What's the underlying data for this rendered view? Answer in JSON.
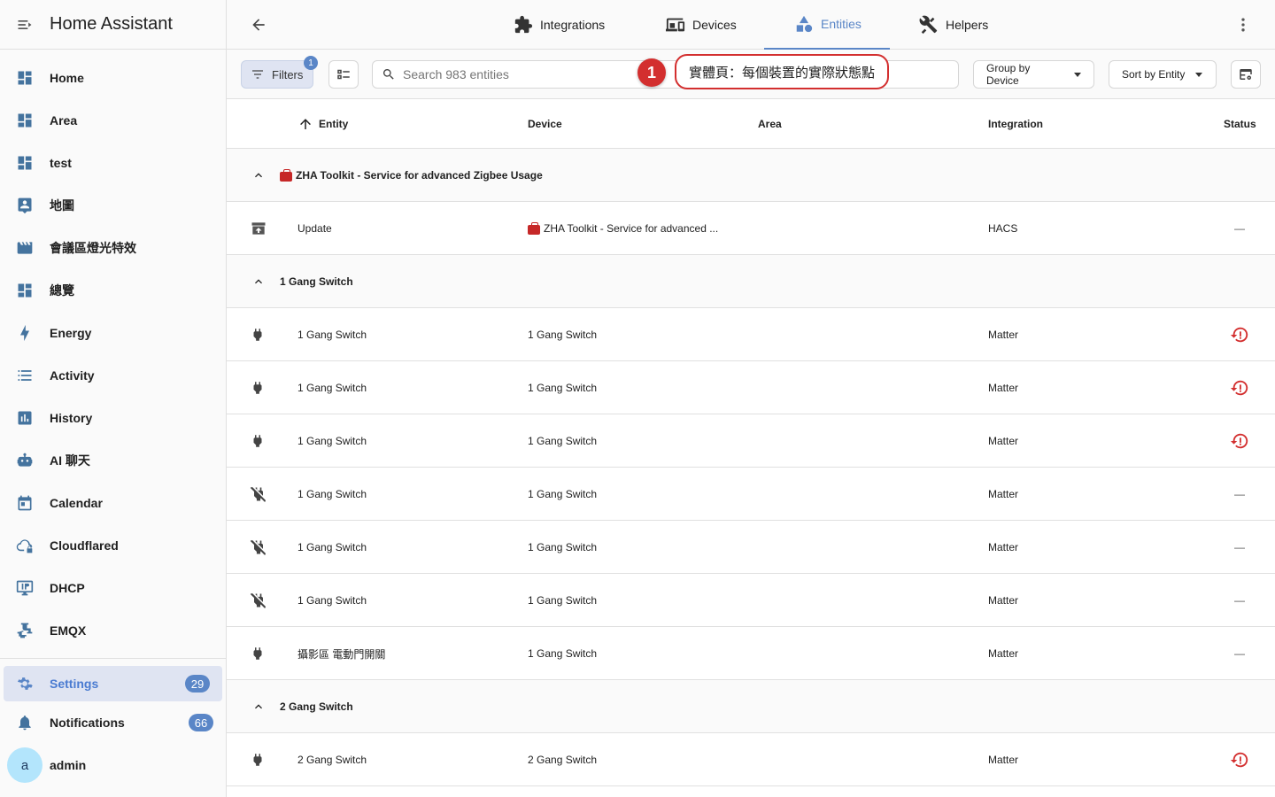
{
  "app": {
    "title": "Home Assistant"
  },
  "sidebar": {
    "items": [
      {
        "label": "Home",
        "icon": "dashboard-icon"
      },
      {
        "label": "Area",
        "icon": "dashboard-icon"
      },
      {
        "label": "test",
        "icon": "dashboard-icon"
      },
      {
        "label": "地圖",
        "icon": "map-person-icon"
      },
      {
        "label": "會議區燈光特效",
        "icon": "movie-icon"
      },
      {
        "label": "總覽",
        "icon": "dashboard-icon"
      },
      {
        "label": "Energy",
        "icon": "lightning-icon"
      },
      {
        "label": "Activity",
        "icon": "list-icon"
      },
      {
        "label": "History",
        "icon": "chart-icon"
      },
      {
        "label": "AI 聊天",
        "icon": "robot-icon"
      },
      {
        "label": "Calendar",
        "icon": "calendar-icon"
      },
      {
        "label": "Cloudflared",
        "icon": "cloud-lock-icon"
      },
      {
        "label": "DHCP",
        "icon": "monitor-ip-icon"
      },
      {
        "label": "EMQX",
        "icon": "pipe-icon"
      }
    ],
    "settings": {
      "label": "Settings",
      "badge": "29"
    },
    "notifications": {
      "label": "Notifications",
      "badge": "66"
    },
    "user": {
      "initial": "a",
      "name": "admin"
    }
  },
  "tabs": [
    {
      "label": "Integrations",
      "icon": "puzzle-icon"
    },
    {
      "label": "Devices",
      "icon": "devices-icon"
    },
    {
      "label": "Entities",
      "icon": "shapes-icon",
      "active": true
    },
    {
      "label": "Helpers",
      "icon": "tools-icon"
    }
  ],
  "toolbar": {
    "filters_label": "Filters",
    "filters_badge": "1",
    "search_placeholder": "Search 983 entities",
    "group_by": "Group by Device",
    "sort_by": "Sort by Entity"
  },
  "annotation": {
    "number": "1",
    "text": "實體頁：每個裝置的實際狀態點"
  },
  "table": {
    "headers": {
      "entity": "Entity",
      "device": "Device",
      "area": "Area",
      "integration": "Integration",
      "status": "Status"
    },
    "groups": [
      {
        "title": "ZHA Toolkit - Service for advanced Zigbee Usage",
        "has_emoji": true,
        "rows": [
          {
            "icon": "update-icon",
            "name": "Update",
            "device": "ZHA Toolkit - Service for advanced ...",
            "device_emoji": true,
            "integration": "HACS",
            "status": "—"
          }
        ]
      },
      {
        "title": "1 Gang Switch",
        "has_emoji": false,
        "rows": [
          {
            "icon": "plug-icon",
            "name": "1 Gang Switch",
            "device": "1 Gang Switch",
            "integration": "Matter",
            "status": "restore-alert"
          },
          {
            "icon": "plug-icon",
            "name": "1 Gang Switch",
            "device": "1 Gang Switch",
            "integration": "Matter",
            "status": "restore-alert"
          },
          {
            "icon": "plug-icon",
            "name": "1 Gang Switch",
            "device": "1 Gang Switch",
            "integration": "Matter",
            "status": "restore-alert"
          },
          {
            "icon": "plug-off-icon",
            "name": "1 Gang Switch",
            "device": "1 Gang Switch",
            "integration": "Matter",
            "status": "—"
          },
          {
            "icon": "plug-off-icon",
            "name": "1 Gang Switch",
            "device": "1 Gang Switch",
            "integration": "Matter",
            "status": "—"
          },
          {
            "icon": "plug-off-icon",
            "name": "1 Gang Switch",
            "device": "1 Gang Switch",
            "integration": "Matter",
            "status": "—"
          },
          {
            "icon": "plug-icon",
            "name": "攝影區 電動門開關",
            "device": "1 Gang Switch",
            "integration": "Matter",
            "status": "—"
          }
        ]
      },
      {
        "title": "2 Gang Switch",
        "has_emoji": false,
        "rows": [
          {
            "icon": "plug-icon",
            "name": "2 Gang Switch",
            "device": "2 Gang Switch",
            "integration": "Matter",
            "status": "restore-alert"
          }
        ]
      }
    ]
  },
  "colors": {
    "accent": "#5a86c7",
    "sidebar_icon": "#44739e",
    "alert": "#d32f2f"
  }
}
